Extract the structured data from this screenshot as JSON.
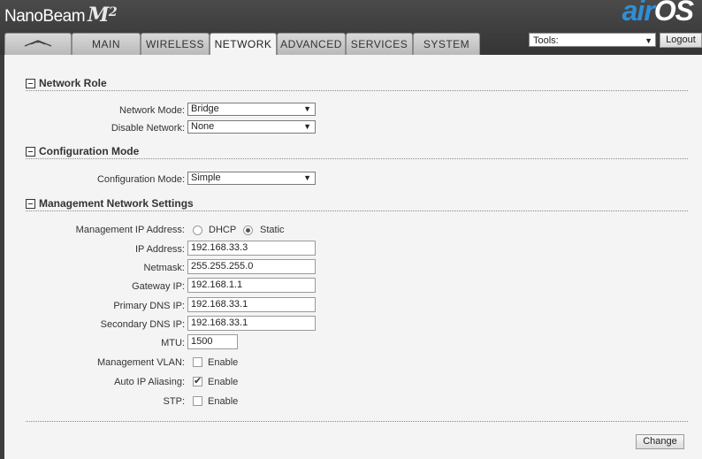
{
  "header": {
    "brand": "NanoBeam",
    "model": "M",
    "model_sup": "2",
    "logo_air": "air",
    "logo_os": "OS"
  },
  "tabs": [
    {
      "label": "",
      "icon": "ubiquiti-logo-icon"
    },
    {
      "label": "MAIN"
    },
    {
      "label": "WIRELESS"
    },
    {
      "label": "NETWORK",
      "active": true
    },
    {
      "label": "ADVANCED"
    },
    {
      "label": "SERVICES"
    },
    {
      "label": "SYSTEM"
    }
  ],
  "tools": {
    "selected": "Tools:",
    "logout_label": "Logout"
  },
  "network_role": {
    "title": "Network Role",
    "network_mode_label": "Network Mode:",
    "network_mode_value": "Bridge",
    "disable_network_label": "Disable Network:",
    "disable_network_value": "None"
  },
  "configuration_mode": {
    "title": "Configuration Mode",
    "label": "Configuration Mode:",
    "value": "Simple"
  },
  "management": {
    "title": "Management Network Settings",
    "ip_address_mode_label": "Management IP Address:",
    "dhcp_label": "DHCP",
    "static_label": "Static",
    "selected_mode": "Static",
    "ip_label": "IP Address:",
    "ip_value": "192.168.33.3",
    "netmask_label": "Netmask:",
    "netmask_value": "255.255.255.0",
    "gateway_label": "Gateway IP:",
    "gateway_value": "192.168.1.1",
    "primary_dns_label": "Primary DNS IP:",
    "primary_dns_value": "192.168.33.1",
    "secondary_dns_label": "Secondary DNS IP:",
    "secondary_dns_value": "192.168.33.1",
    "mtu_label": "MTU:",
    "mtu_value": "1500",
    "vlan_label": "Management VLAN:",
    "vlan_enable": "Enable",
    "vlan_checked": false,
    "aliasing_label": "Auto IP Aliasing:",
    "aliasing_enable": "Enable",
    "aliasing_checked": true,
    "stp_label": "STP:",
    "stp_enable": "Enable",
    "stp_checked": false
  },
  "change_label": "Change",
  "colors": {
    "air_blue": "#2f8fd6",
    "header_bg": "#3d3d3d",
    "panel_bg": "#f4f4f4"
  }
}
